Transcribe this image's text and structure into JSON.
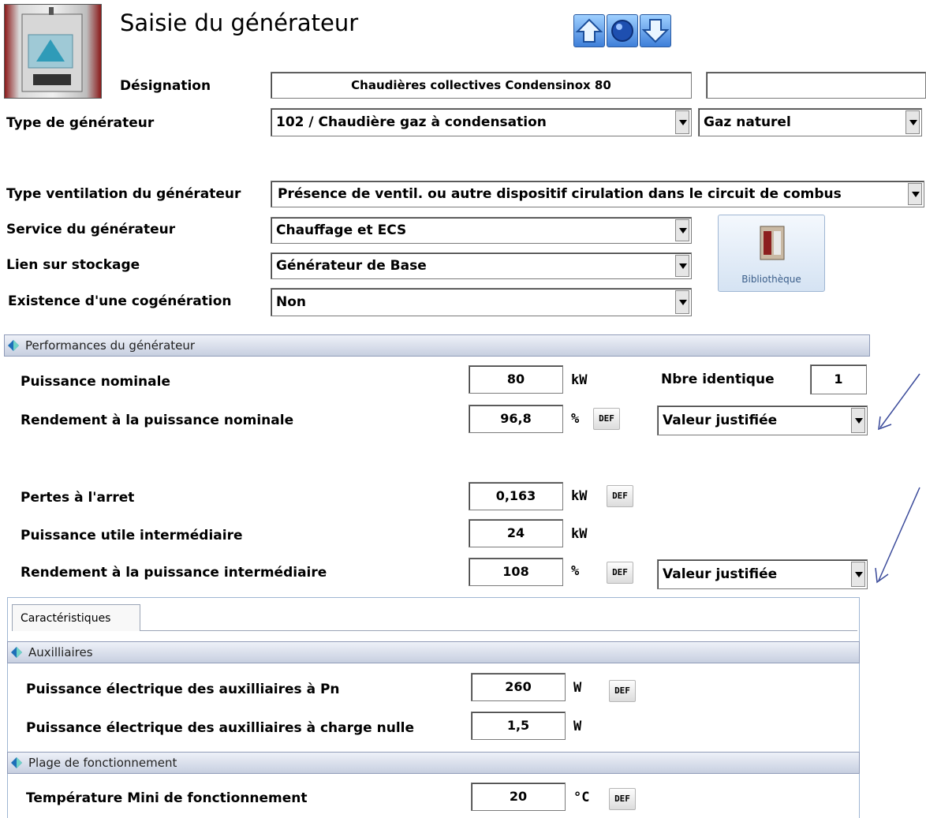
{
  "header": {
    "title": "Saisie du générateur",
    "designation_label": "Désignation",
    "designation_value": "Chaudières collectives Condensinox 80",
    "designation_extra": "",
    "nav_up_icon": "up-arrow-icon",
    "nav_center_icon": "circle-icon",
    "nav_down_icon": "down-arrow-icon"
  },
  "main": {
    "type_generateur_label": "Type de générateur",
    "type_generateur_value": "102 / Chaudière gaz à condensation",
    "energie_value": "Gaz naturel",
    "ventilation_label": "Type ventilation du générateur",
    "ventilation_value": "Présence de ventil. ou autre dispositif cirulation dans le circuit de combus",
    "service_label": "Service du générateur",
    "service_value": "Chauffage et ECS",
    "stockage_label": "Lien sur stockage",
    "stockage_value": "Générateur de Base",
    "cogeneration_label": "Existence d'une cogénération",
    "cogeneration_value": "Non",
    "bibliotheque_label": "Bibliothèque"
  },
  "performances": {
    "section_title": "Performances du générateur",
    "puissance_nominale_label": "Puissance nominale",
    "puissance_nominale_value": "80",
    "puissance_nominale_unit": "kW",
    "nbre_identique_label": "Nbre identique",
    "nbre_identique_value": "1",
    "rendement_nominal_label": "Rendement à la puissance nominale",
    "rendement_nominal_value": "96,8",
    "rendement_nominal_unit": "%",
    "rendement_nominal_select": "Valeur justifiée",
    "pertes_label": "Pertes à l'arret",
    "pertes_value": "0,163",
    "pertes_unit": "kW",
    "puissance_inter_label": "Puissance utile intermédiaire",
    "puissance_inter_value": "24",
    "puissance_inter_unit": "kW",
    "rendement_inter_label": "Rendement à la puissance intermédiaire",
    "rendement_inter_value": "108",
    "rendement_inter_unit": "%",
    "rendement_inter_select": "Valeur justifiée",
    "def_label": "DEF"
  },
  "caracteristiques": {
    "tab_label": "Caractéristiques",
    "auxiliaires_title": "Auxilliaires",
    "aux_pn_label": "Puissance électrique des  auxilliaires à Pn",
    "aux_pn_value": "260",
    "aux_pn_unit": "W",
    "aux_nulle_label": "Puissance électrique des auxilliaires à charge nulle",
    "aux_nulle_value": "1,5",
    "aux_nulle_unit": "W",
    "plage_title": "Plage de fonctionnement",
    "temp_mini_label": "Température Mini de fonctionnement",
    "temp_mini_value": "20",
    "temp_mini_unit": "°C"
  }
}
